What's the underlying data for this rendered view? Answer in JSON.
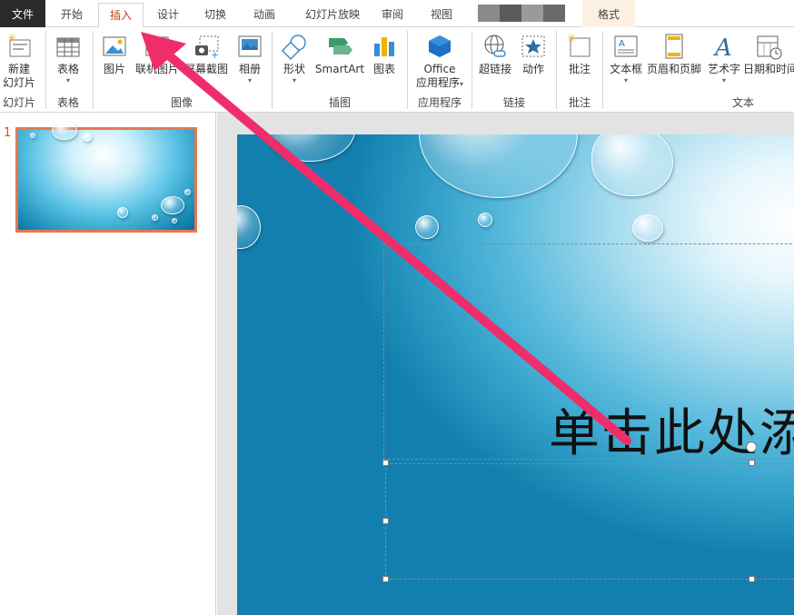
{
  "tabs": [
    {
      "label": "文件"
    },
    {
      "label": "开始"
    },
    {
      "label": "插入"
    },
    {
      "label": "设计"
    },
    {
      "label": "切换"
    },
    {
      "label": "动画"
    },
    {
      "label": "幻灯片放映"
    },
    {
      "label": "审阅"
    },
    {
      "label": "视图"
    },
    {
      "label": "格式"
    }
  ],
  "ribbon": {
    "buttons": [
      {
        "label": "新建",
        "label2": "幻灯片",
        "icon": "new-slide-icon"
      },
      {
        "label": "表格",
        "icon": "table-icon"
      },
      {
        "label": "图片",
        "icon": "picture-icon"
      },
      {
        "label": "联机图片",
        "icon": "online-picture-icon"
      },
      {
        "label": "屏幕截图",
        "icon": "screenshot-icon"
      },
      {
        "label": "相册",
        "icon": "photo-album-icon"
      },
      {
        "label": "形状",
        "icon": "shapes-icon"
      },
      {
        "label": "SmartArt",
        "icon": "smartart-icon"
      },
      {
        "label": "图表",
        "icon": "chart-icon"
      },
      {
        "label": "Office",
        "label2": "应用程序",
        "icon": "office-apps-icon"
      },
      {
        "label": "超链接",
        "icon": "hyperlink-icon"
      },
      {
        "label": "动作",
        "icon": "action-icon"
      },
      {
        "label": "批注",
        "icon": "comment-icon"
      },
      {
        "label": "文本框",
        "icon": "textbox-icon"
      },
      {
        "label": "页眉和页脚",
        "icon": "header-footer-icon"
      },
      {
        "label": "艺术字",
        "icon": "wordart-icon"
      },
      {
        "label": "日期和时间",
        "icon": "date-time-icon"
      }
    ],
    "groups": [
      {
        "label": "幻灯片"
      },
      {
        "label": "表格"
      },
      {
        "label": "图像"
      },
      {
        "label": "插图"
      },
      {
        "label": "应用程序"
      },
      {
        "label": "链接"
      },
      {
        "label": "批注"
      },
      {
        "label": "文本"
      }
    ]
  },
  "thumbnails": {
    "slide_number": "1"
  },
  "slide": {
    "title_placeholder": "单击此处添"
  },
  "colors": {
    "accent": "#c43e1c",
    "annotation_arrow": "#ef2d6a",
    "thumbnail_border": "#e8774f"
  }
}
